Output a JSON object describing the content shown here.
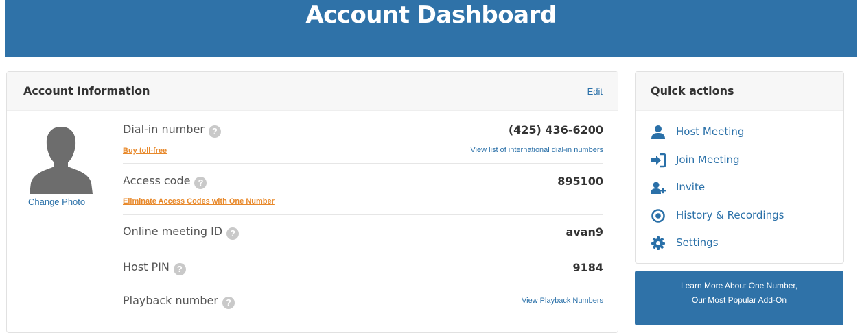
{
  "page": {
    "title": "Account Dashboard"
  },
  "account": {
    "title": "Account Information",
    "edit_label": "Edit",
    "change_photo": "Change Photo",
    "rows": [
      {
        "label": "Dial-in number",
        "value": "(425) 436-6200",
        "sublink": "Buy toll-free",
        "rightlink": "View list of international dial-in numbers"
      },
      {
        "label": "Access code",
        "value": "895100",
        "sublink": "Eliminate Access Codes with One Number"
      },
      {
        "label": "Online meeting ID",
        "value": "avan9"
      },
      {
        "label": "Host PIN",
        "value": "9184"
      },
      {
        "label": "Playback number",
        "rightlink": "View Playback Numbers"
      }
    ]
  },
  "quick_actions": {
    "title": "Quick actions",
    "items": [
      {
        "label": "Host Meeting",
        "icon": "person-icon"
      },
      {
        "label": "Join Meeting",
        "icon": "sign-in-icon"
      },
      {
        "label": "Invite",
        "icon": "add-user-icon"
      },
      {
        "label": "History & Recordings",
        "icon": "record-icon"
      },
      {
        "label": "Settings",
        "icon": "gear-icon"
      }
    ]
  },
  "promo": {
    "line1": "Learn More About One Number,",
    "line2": "Our Most Popular Add-On"
  },
  "colors": {
    "brand": "#2f72a8",
    "link": "#2a70a8",
    "accent_orange": "#e8892b"
  }
}
